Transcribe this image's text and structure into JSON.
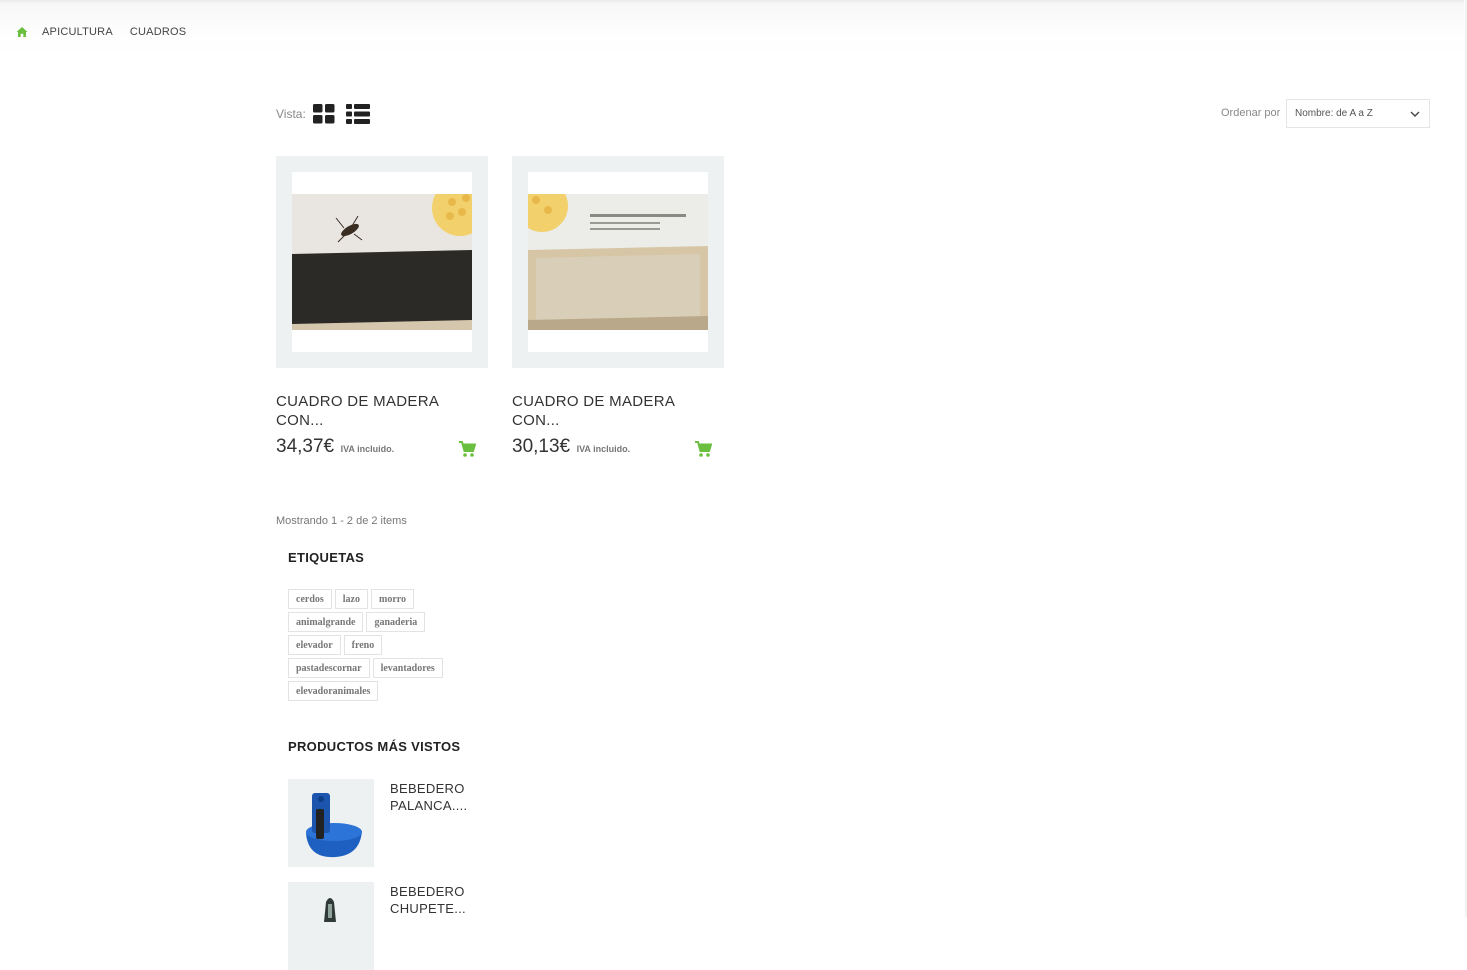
{
  "breadcrumb": {
    "items": [
      {
        "label": "APICULTURA"
      },
      {
        "label": "CUADROS"
      }
    ]
  },
  "toolbar": {
    "view_label": "Vista:",
    "sort_label": "Ordenar por",
    "sort_value": "Nombre: de A a Z"
  },
  "products": [
    {
      "name_line1": "CUADRO DE MADERA",
      "name_line2": "CON...",
      "price": "34,37€",
      "tax": "IVA incluido."
    },
    {
      "name_line1": "CUADRO DE MADERA",
      "name_line2": "CON...",
      "price": "30,13€",
      "tax": "IVA incluido."
    }
  ],
  "listing": {
    "showing": "Mostrando 1 - 2 de 2 items"
  },
  "tags": {
    "title": "ETIQUETAS",
    "rows": [
      [
        "cerdos",
        "lazo",
        "morro"
      ],
      [
        "animalgrande",
        "ganaderia"
      ],
      [
        "elevador",
        "freno"
      ],
      [
        "pastadescornar",
        "levantadores"
      ],
      [
        "elevadoranimales"
      ]
    ]
  },
  "most_viewed": {
    "title": "PRODUCTOS MÁS VISTOS",
    "items": [
      {
        "line1": "BEBEDERO",
        "line2": "PALANCA...."
      },
      {
        "line1": "BEBEDERO",
        "line2": "CHUPETE..."
      }
    ]
  },
  "colors": {
    "accent_green": "#6bbf3f",
    "frame_bg": "#eef1f1"
  },
  "icons": [
    "home-icon",
    "grid-view-icon",
    "list-view-icon",
    "chevron-down-icon",
    "cart-icon"
  ]
}
